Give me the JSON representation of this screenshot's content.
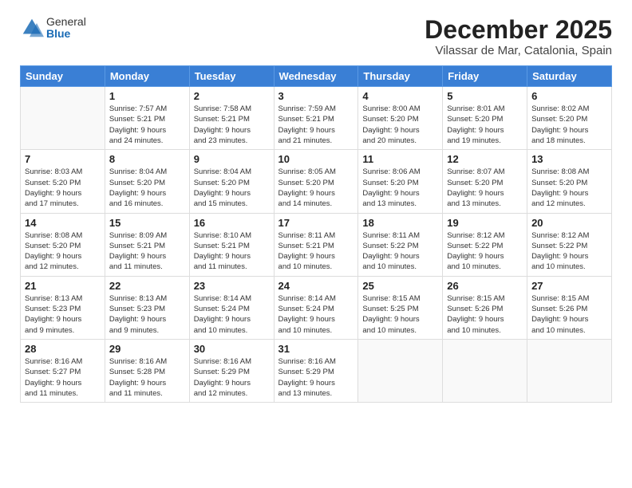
{
  "header": {
    "logo_general": "General",
    "logo_blue": "Blue",
    "month_title": "December 2025",
    "location": "Vilassar de Mar, Catalonia, Spain"
  },
  "weekdays": [
    "Sunday",
    "Monday",
    "Tuesday",
    "Wednesday",
    "Thursday",
    "Friday",
    "Saturday"
  ],
  "weeks": [
    [
      {
        "day": "",
        "info": ""
      },
      {
        "day": "1",
        "info": "Sunrise: 7:57 AM\nSunset: 5:21 PM\nDaylight: 9 hours\nand 24 minutes."
      },
      {
        "day": "2",
        "info": "Sunrise: 7:58 AM\nSunset: 5:21 PM\nDaylight: 9 hours\nand 23 minutes."
      },
      {
        "day": "3",
        "info": "Sunrise: 7:59 AM\nSunset: 5:21 PM\nDaylight: 9 hours\nand 21 minutes."
      },
      {
        "day": "4",
        "info": "Sunrise: 8:00 AM\nSunset: 5:20 PM\nDaylight: 9 hours\nand 20 minutes."
      },
      {
        "day": "5",
        "info": "Sunrise: 8:01 AM\nSunset: 5:20 PM\nDaylight: 9 hours\nand 19 minutes."
      },
      {
        "day": "6",
        "info": "Sunrise: 8:02 AM\nSunset: 5:20 PM\nDaylight: 9 hours\nand 18 minutes."
      }
    ],
    [
      {
        "day": "7",
        "info": "Sunrise: 8:03 AM\nSunset: 5:20 PM\nDaylight: 9 hours\nand 17 minutes."
      },
      {
        "day": "8",
        "info": "Sunrise: 8:04 AM\nSunset: 5:20 PM\nDaylight: 9 hours\nand 16 minutes."
      },
      {
        "day": "9",
        "info": "Sunrise: 8:04 AM\nSunset: 5:20 PM\nDaylight: 9 hours\nand 15 minutes."
      },
      {
        "day": "10",
        "info": "Sunrise: 8:05 AM\nSunset: 5:20 PM\nDaylight: 9 hours\nand 14 minutes."
      },
      {
        "day": "11",
        "info": "Sunrise: 8:06 AM\nSunset: 5:20 PM\nDaylight: 9 hours\nand 13 minutes."
      },
      {
        "day": "12",
        "info": "Sunrise: 8:07 AM\nSunset: 5:20 PM\nDaylight: 9 hours\nand 13 minutes."
      },
      {
        "day": "13",
        "info": "Sunrise: 8:08 AM\nSunset: 5:20 PM\nDaylight: 9 hours\nand 12 minutes."
      }
    ],
    [
      {
        "day": "14",
        "info": "Sunrise: 8:08 AM\nSunset: 5:20 PM\nDaylight: 9 hours\nand 12 minutes."
      },
      {
        "day": "15",
        "info": "Sunrise: 8:09 AM\nSunset: 5:21 PM\nDaylight: 9 hours\nand 11 minutes."
      },
      {
        "day": "16",
        "info": "Sunrise: 8:10 AM\nSunset: 5:21 PM\nDaylight: 9 hours\nand 11 minutes."
      },
      {
        "day": "17",
        "info": "Sunrise: 8:11 AM\nSunset: 5:21 PM\nDaylight: 9 hours\nand 10 minutes."
      },
      {
        "day": "18",
        "info": "Sunrise: 8:11 AM\nSunset: 5:22 PM\nDaylight: 9 hours\nand 10 minutes."
      },
      {
        "day": "19",
        "info": "Sunrise: 8:12 AM\nSunset: 5:22 PM\nDaylight: 9 hours\nand 10 minutes."
      },
      {
        "day": "20",
        "info": "Sunrise: 8:12 AM\nSunset: 5:22 PM\nDaylight: 9 hours\nand 10 minutes."
      }
    ],
    [
      {
        "day": "21",
        "info": "Sunrise: 8:13 AM\nSunset: 5:23 PM\nDaylight: 9 hours\nand 9 minutes."
      },
      {
        "day": "22",
        "info": "Sunrise: 8:13 AM\nSunset: 5:23 PM\nDaylight: 9 hours\nand 9 minutes."
      },
      {
        "day": "23",
        "info": "Sunrise: 8:14 AM\nSunset: 5:24 PM\nDaylight: 9 hours\nand 10 minutes."
      },
      {
        "day": "24",
        "info": "Sunrise: 8:14 AM\nSunset: 5:24 PM\nDaylight: 9 hours\nand 10 minutes."
      },
      {
        "day": "25",
        "info": "Sunrise: 8:15 AM\nSunset: 5:25 PM\nDaylight: 9 hours\nand 10 minutes."
      },
      {
        "day": "26",
        "info": "Sunrise: 8:15 AM\nSunset: 5:26 PM\nDaylight: 9 hours\nand 10 minutes."
      },
      {
        "day": "27",
        "info": "Sunrise: 8:15 AM\nSunset: 5:26 PM\nDaylight: 9 hours\nand 10 minutes."
      }
    ],
    [
      {
        "day": "28",
        "info": "Sunrise: 8:16 AM\nSunset: 5:27 PM\nDaylight: 9 hours\nand 11 minutes."
      },
      {
        "day": "29",
        "info": "Sunrise: 8:16 AM\nSunset: 5:28 PM\nDaylight: 9 hours\nand 11 minutes."
      },
      {
        "day": "30",
        "info": "Sunrise: 8:16 AM\nSunset: 5:29 PM\nDaylight: 9 hours\nand 12 minutes."
      },
      {
        "day": "31",
        "info": "Sunrise: 8:16 AM\nSunset: 5:29 PM\nDaylight: 9 hours\nand 13 minutes."
      },
      {
        "day": "",
        "info": ""
      },
      {
        "day": "",
        "info": ""
      },
      {
        "day": "",
        "info": ""
      }
    ]
  ]
}
